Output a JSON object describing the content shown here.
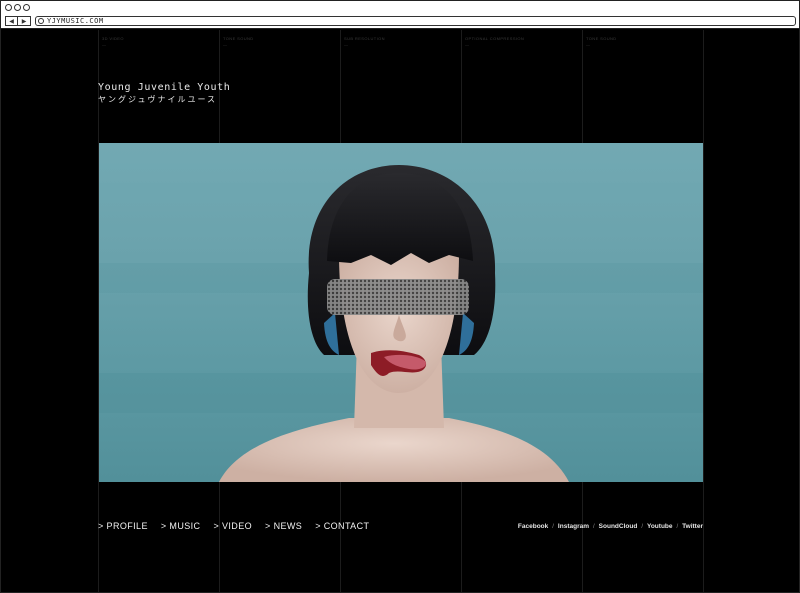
{
  "browser": {
    "url": "YJYMUSIC.COM"
  },
  "site": {
    "logo": {
      "en": "Young Juvenile Youth",
      "jp": "ヤングジュヴナイルユース"
    },
    "columns": [
      {
        "label": "3D VIDEO",
        "dash": "—"
      },
      {
        "label": "TONE SOUND",
        "dash": "—"
      },
      {
        "label": "SUB RESOLUTION",
        "dash": "—"
      },
      {
        "label": "OPTIONAL COMPRESSION",
        "dash": "—"
      },
      {
        "label": "TONE SOUND",
        "dash": "—"
      }
    ],
    "nav": [
      {
        "label": "> PROFILE"
      },
      {
        "label": "> MUSIC"
      },
      {
        "label": "> VIDEO"
      },
      {
        "label": "> NEWS"
      },
      {
        "label": "> CONTACT"
      }
    ],
    "social": [
      {
        "label": "Facebook"
      },
      {
        "label": "Instagram"
      },
      {
        "label": "SoundCloud"
      },
      {
        "label": "Youtube"
      },
      {
        "label": "Twitter"
      }
    ],
    "social_separator": "/",
    "colors": {
      "background": "#000000",
      "hero_teal": "#6aa2ac",
      "text": "#f2f2f2"
    }
  }
}
